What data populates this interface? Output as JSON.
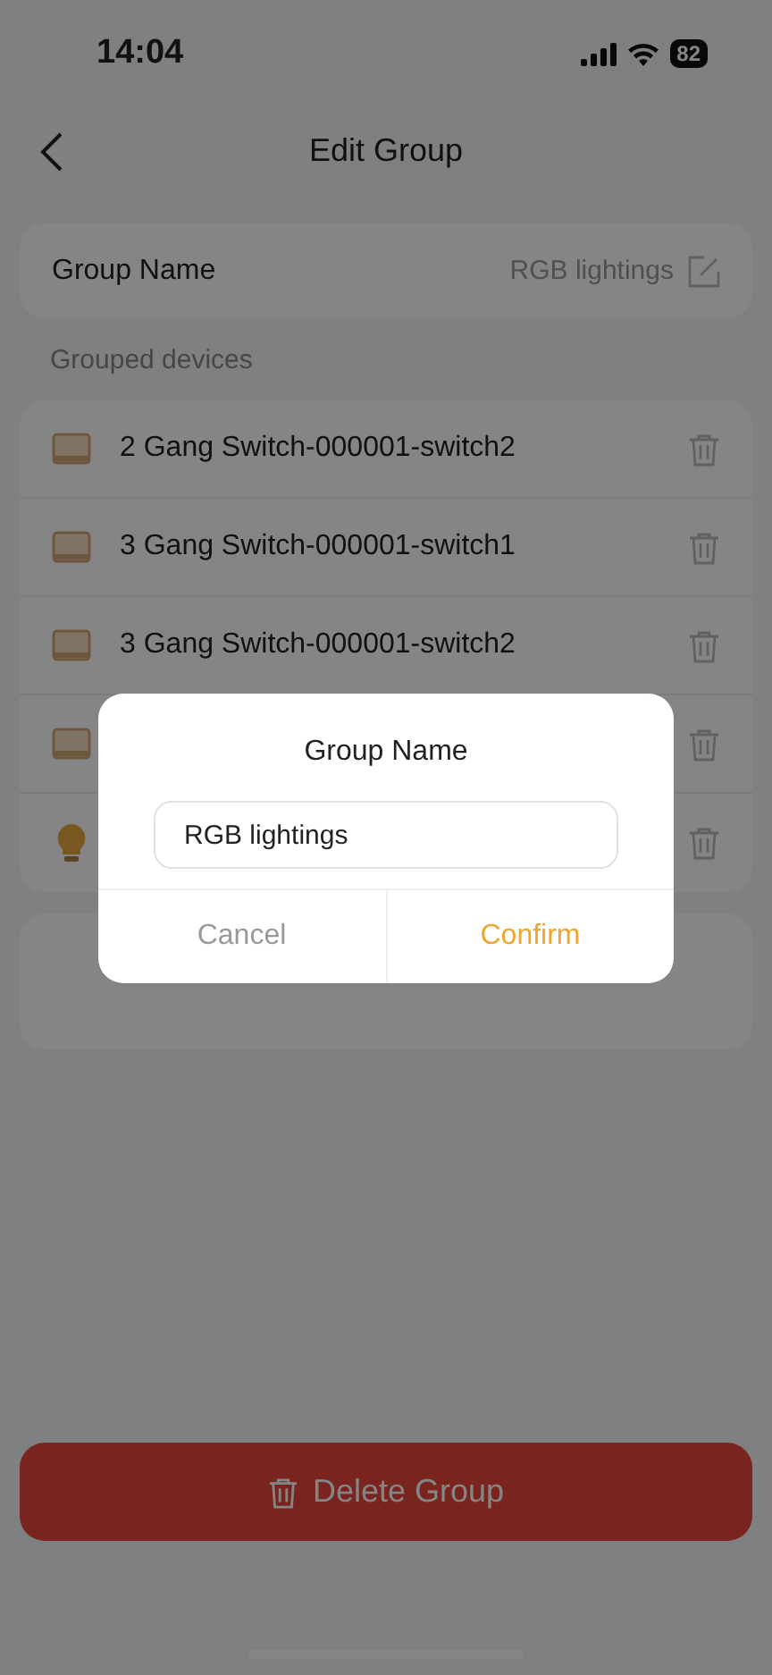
{
  "status_bar": {
    "time": "14:04",
    "battery": "82"
  },
  "header": {
    "title": "Edit Group"
  },
  "group_name_row": {
    "label": "Group Name",
    "value": "RGB lightings"
  },
  "section_label": "Grouped devices",
  "devices": [
    {
      "kind": "switch",
      "name": "2 Gang Switch-000001-switch2"
    },
    {
      "kind": "switch",
      "name": "3 Gang Switch-000001-switch1"
    },
    {
      "kind": "switch",
      "name": "3 Gang Switch-000001-switch2"
    },
    {
      "kind": "switch"
    },
    {
      "kind": "bulb"
    }
  ],
  "delete_button": {
    "label": "Delete Group"
  },
  "dialog": {
    "title": "Group Name",
    "input_value": "RGB lightings",
    "buttons": [
      {
        "label": "Cancel",
        "kind": "cancel"
      },
      {
        "label": "Confirm",
        "kind": "confirm"
      }
    ]
  }
}
